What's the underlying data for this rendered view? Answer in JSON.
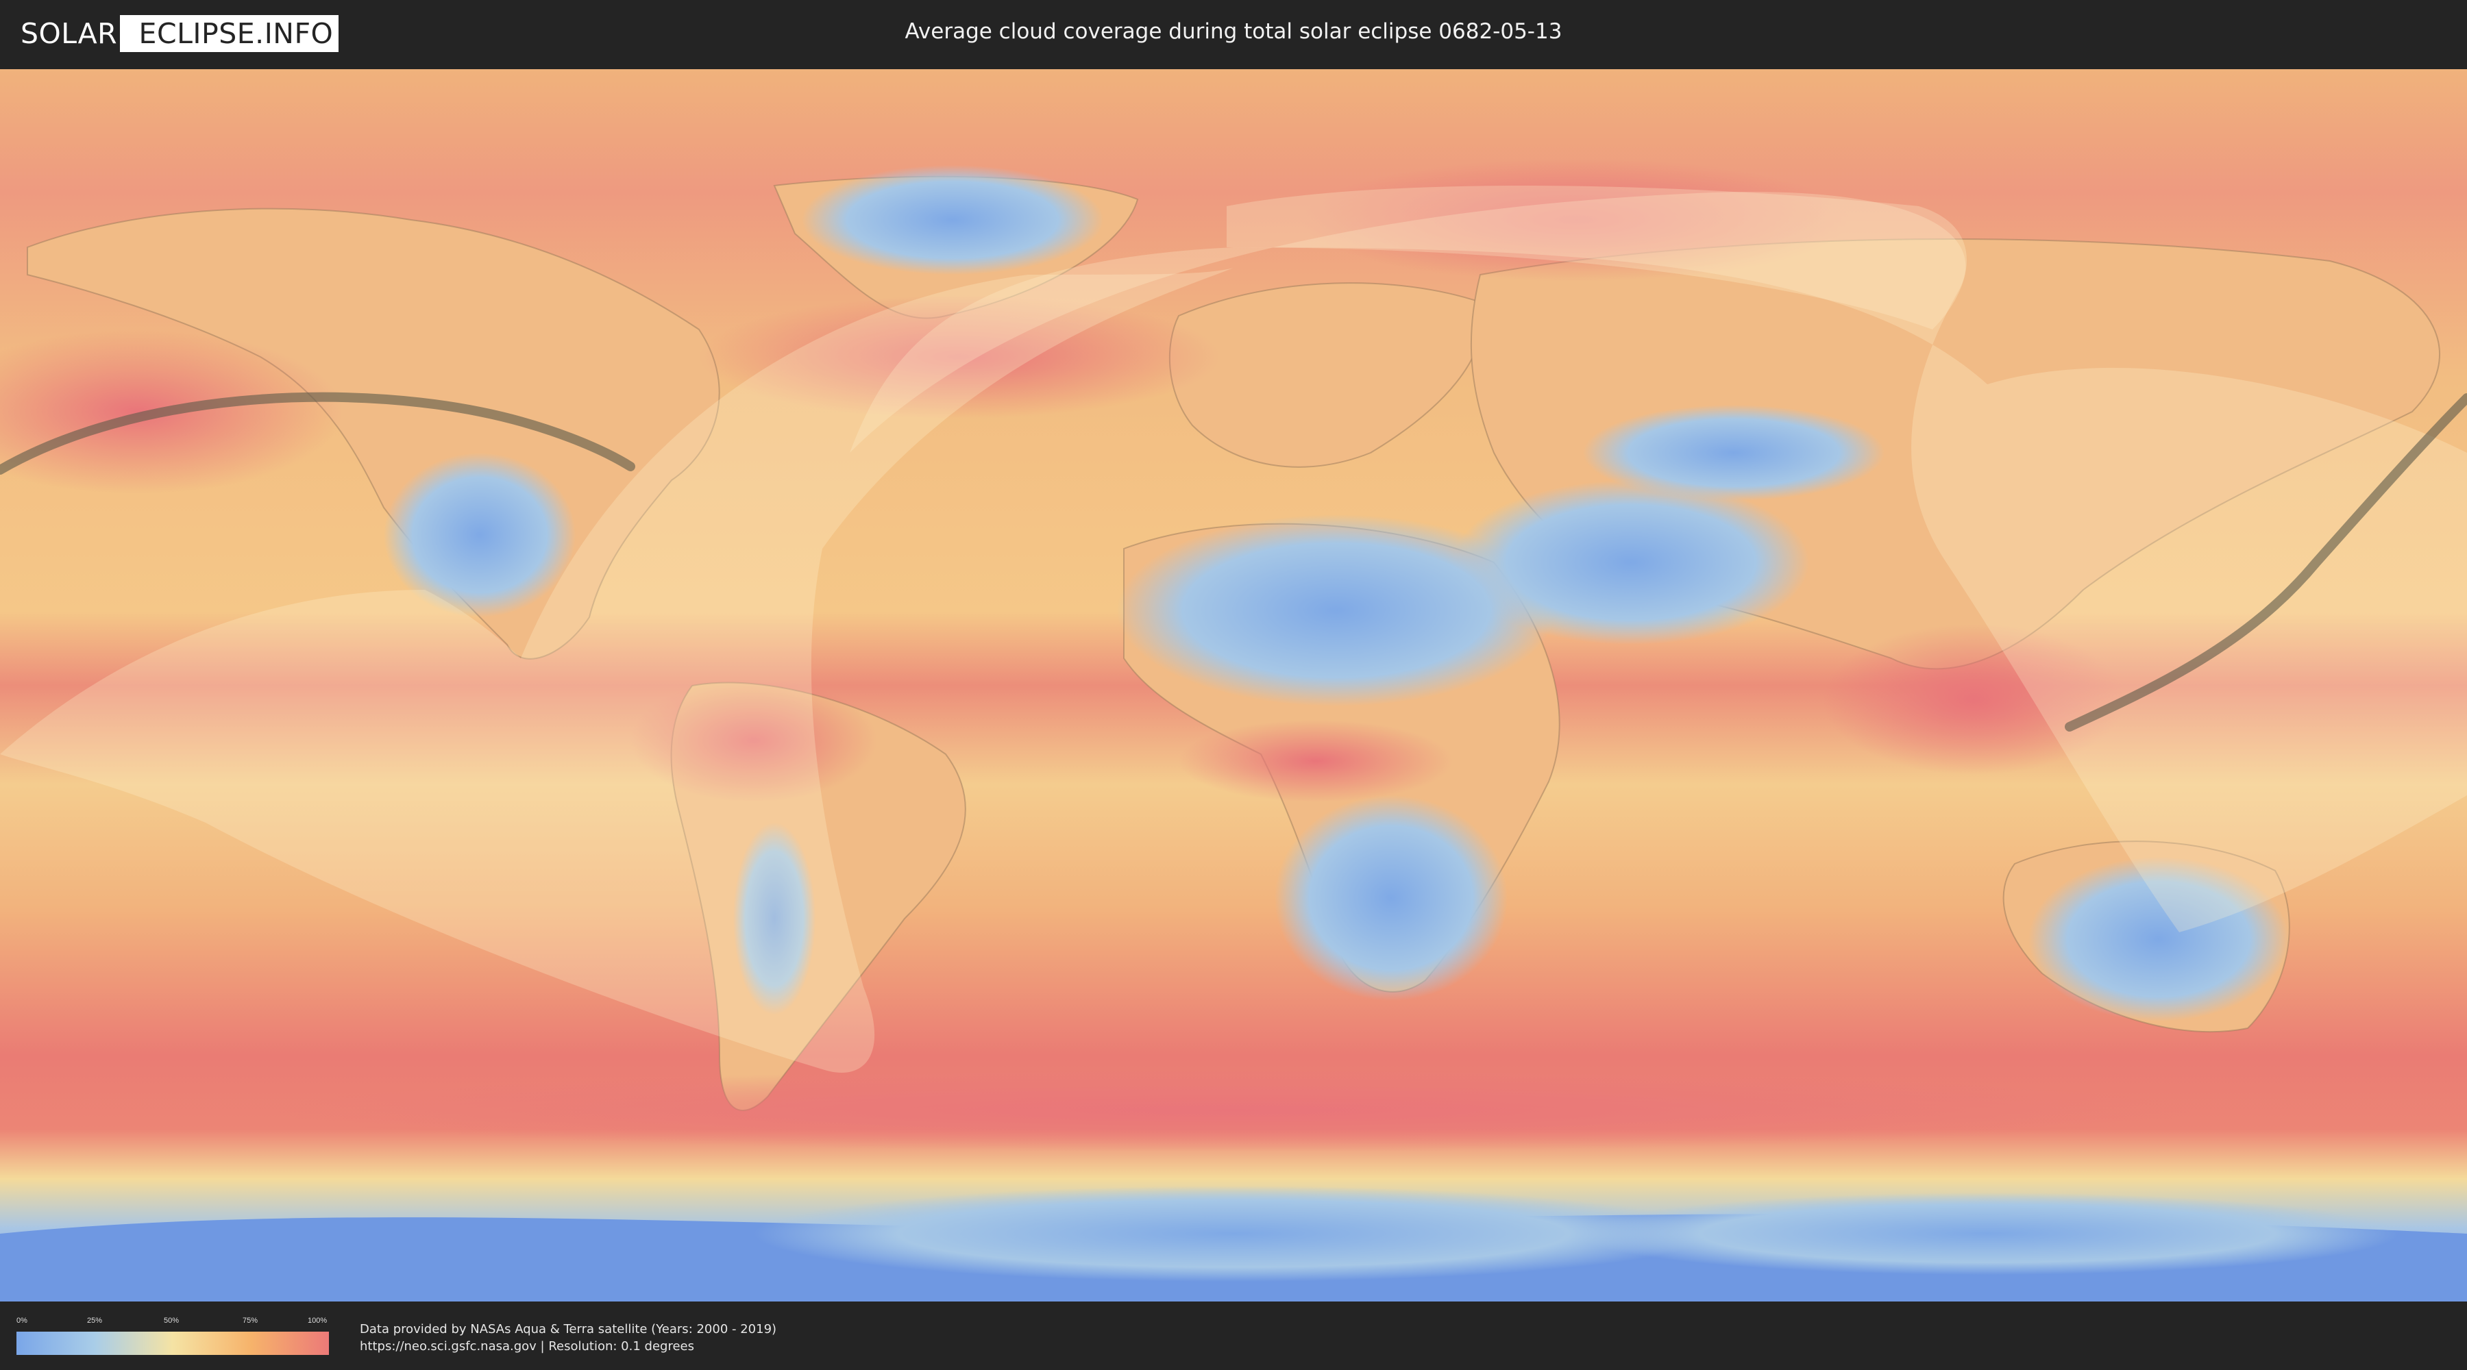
{
  "header": {
    "logo_left": "SOLAR",
    "logo_right": "ECLIPSE.INFO",
    "title": "Average cloud coverage during total solar eclipse 0682-05-13"
  },
  "map": {
    "layer": "cloud-coverage-map",
    "colors": {
      "clear": "#7aa6e8",
      "low": "#a9cde8",
      "mid": "#f5e3a4",
      "high": "#f6b36b",
      "overcast": "#ec7a78",
      "eclipse_path": "#5e5a4a",
      "visibility_zone": "#fff4d2"
    }
  },
  "legend": {
    "ticks": [
      "0%",
      "25%",
      "50%",
      "75%",
      "100%"
    ]
  },
  "footer": {
    "credit_line_1": "Data provided by NASAs Aqua & Terra satellite (Years: 2000 - 2019)",
    "credit_line_2": "https://neo.sci.gsfc.nasa.gov | Resolution: 0.1 degrees"
  }
}
